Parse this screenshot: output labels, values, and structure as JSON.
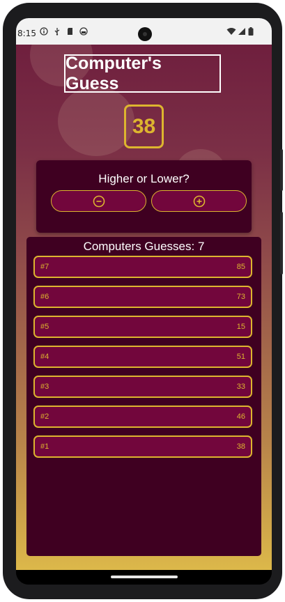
{
  "status_bar": {
    "time": "8:15",
    "left_icons": [
      "info-icon",
      "usb-icon",
      "sd-card-icon",
      "android-icon"
    ],
    "right_icons": [
      "wifi-icon",
      "signal-icon",
      "battery-icon"
    ]
  },
  "app": {
    "title": "Computer's Guess",
    "current_guess": "38",
    "prompt": "Higher or Lower?",
    "lower_button_icon": "minus-circle-icon",
    "higher_button_icon": "plus-circle-icon",
    "log_title": "Computers Guesses: 7",
    "guesses": [
      {
        "round": "#7",
        "value": "85"
      },
      {
        "round": "#6",
        "value": "73"
      },
      {
        "round": "#5",
        "value": "15"
      },
      {
        "round": "#4",
        "value": "51"
      },
      {
        "round": "#3",
        "value": "33"
      },
      {
        "round": "#2",
        "value": "46"
      },
      {
        "round": "#1",
        "value": "38"
      }
    ]
  },
  "colors": {
    "accent": "#ddb52f",
    "card_background": "#3f0021",
    "button_background": "#72063c",
    "gradient_top": "#6f1f3e",
    "gradient_bottom": "#dcb84a"
  }
}
